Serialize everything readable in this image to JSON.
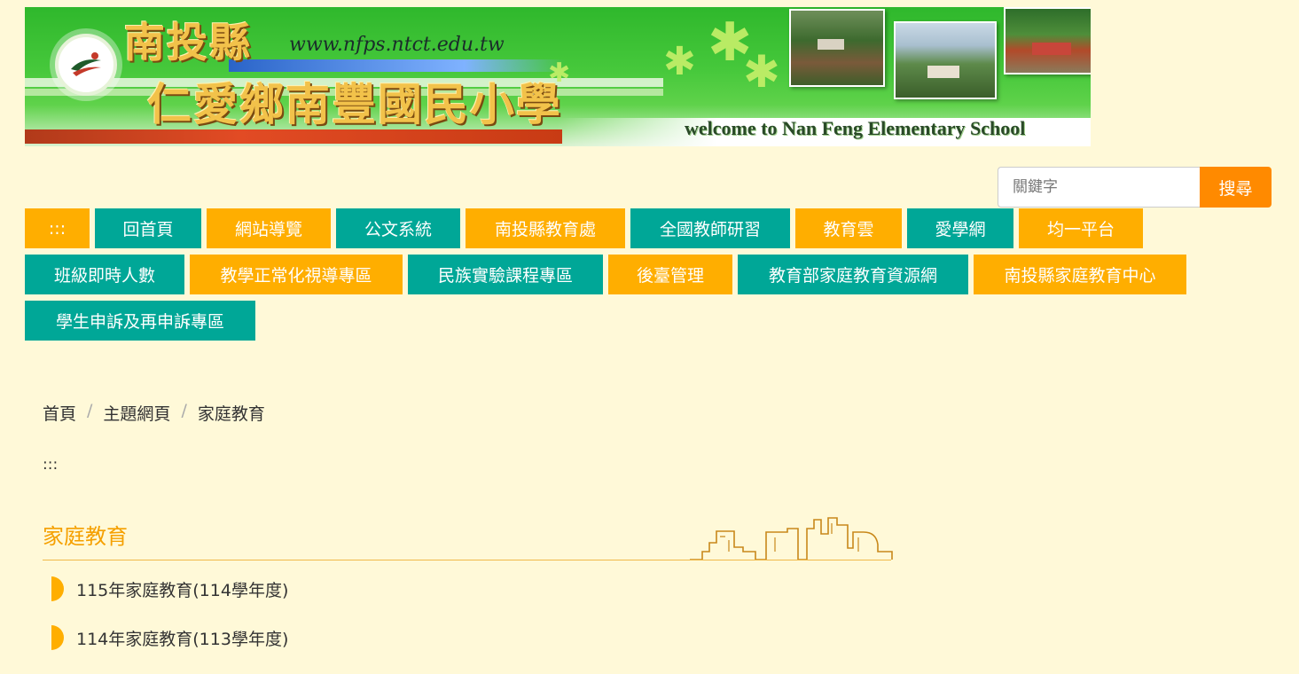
{
  "banner": {
    "title_line1": "南投縣",
    "title_line2": "仁愛鄉南豐國民小學",
    "url": "www.nfps.ntct.edu.tw",
    "welcome": "welcome to Nan Feng Elementary School"
  },
  "search": {
    "placeholder": "關鍵字",
    "button_label": "搜尋"
  },
  "nav": {
    "row1": [
      {
        "label": ":::",
        "color": "orange"
      },
      {
        "label": "回首頁",
        "color": "teal"
      },
      {
        "label": "網站導覽",
        "color": "orange"
      },
      {
        "label": "公文系統",
        "color": "teal"
      },
      {
        "label": "南投縣教育處",
        "color": "orange"
      },
      {
        "label": "全國教師研習",
        "color": "teal"
      },
      {
        "label": "教育雲",
        "color": "orange"
      },
      {
        "label": "愛學網",
        "color": "teal"
      },
      {
        "label": "均一平台",
        "color": "orange"
      }
    ],
    "row2": [
      {
        "label": "班級即時人數",
        "color": "teal"
      },
      {
        "label": "教學正常化視導專區",
        "color": "orange"
      },
      {
        "label": "民族實驗課程專區",
        "color": "teal"
      },
      {
        "label": "後臺管理",
        "color": "orange"
      },
      {
        "label": "教育部家庭教育資源網",
        "color": "teal"
      },
      {
        "label": "南投縣家庭教育中心",
        "color": "orange"
      }
    ],
    "row3": [
      {
        "label": "學生申訴及再申訴專區",
        "color": "teal"
      }
    ]
  },
  "breadcrumb": {
    "items": [
      "首頁",
      "主題網頁",
      "家庭教育"
    ],
    "separator": "/"
  },
  "anchor": ":::",
  "section": {
    "title": "家庭教育",
    "items": [
      "115年家庭教育(114學年度)",
      "114年家庭教育(113學年度)"
    ]
  },
  "colors": {
    "background": "#fff9d8",
    "orange": "#ffae00",
    "teal": "#00a797",
    "search_button": "#ff8a00",
    "section_title": "#f5a000"
  }
}
